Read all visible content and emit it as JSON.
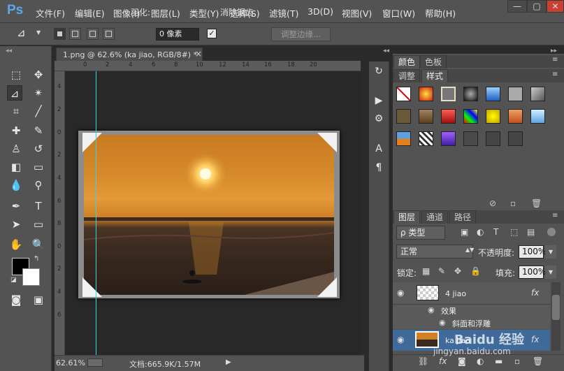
{
  "app_logo": "Ps",
  "menu": [
    "文件(F)",
    "编辑(E)",
    "图像(I)",
    "图层(L)",
    "类型(Y)",
    "选择(S)",
    "滤镜(T)",
    "3D(D)",
    "视图(V)",
    "窗口(W)",
    "帮助(H)"
  ],
  "window_controls": {
    "minimize": "—",
    "restore": "▢",
    "close": "✕"
  },
  "options": {
    "feather_label": "羽化:",
    "feather_value": "0 像素",
    "antialias_check": "✓",
    "antialias_label": "消除锯齿",
    "refine_label": "调整边缘..."
  },
  "document": {
    "tab_title": "1.png @ 62.6% (ka jiao, RGB/8#) *",
    "tab_close": "×",
    "ruler_h": [
      "0",
      "2",
      "4",
      "6",
      "8",
      "10",
      "12",
      "14",
      "16",
      "18",
      "20"
    ],
    "ruler_v": [
      "4",
      "2",
      "0",
      "2",
      "4",
      "6",
      "8",
      "0",
      "2",
      "4",
      "6"
    ]
  },
  "status": {
    "zoom": "62.61%",
    "doc_info": "文档:665.9K/1.57M",
    "arrow": "▶"
  },
  "panels": {
    "color_tabs": [
      "颜色",
      "色板"
    ],
    "style_tabs": [
      "调整",
      "样式"
    ],
    "layers_tabs": [
      "图层",
      "通道",
      "路径"
    ],
    "filter_kind": "ρ 类型",
    "blend_mode": "正常",
    "opacity_label": "不透明度:",
    "opacity_value": "100%",
    "lock_label": "锁定:",
    "fill_label": "填充:",
    "fill_value": "100%",
    "layers": [
      {
        "name": "4 jiao",
        "fx": "fx"
      },
      {
        "name": "ka jiao",
        "fx": "fx"
      }
    ],
    "effects_label": "效果",
    "bevel_label": "斜面和浮雕",
    "eye": "👁"
  },
  "watermark": {
    "line1": "Baidu 经验",
    "line2": "jingyan.baidu.com"
  }
}
